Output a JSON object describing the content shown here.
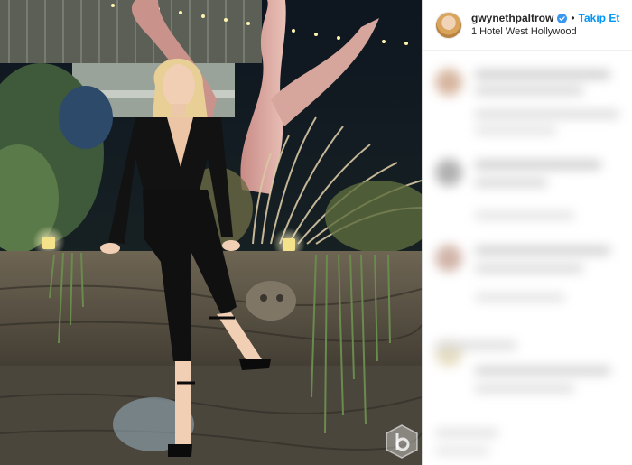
{
  "post": {
    "username": "gwynethpaltrow",
    "follow_label": "Takip Et",
    "separator": "•",
    "location": "1 Hotel West Hollywood"
  },
  "icons": {
    "verified": "verified-badge-icon",
    "watermark": "watermark-logo-icon"
  },
  "colors": {
    "follow_blue": "#0095f6",
    "verified_blue": "#3897f0",
    "text_dark": "#262626"
  }
}
